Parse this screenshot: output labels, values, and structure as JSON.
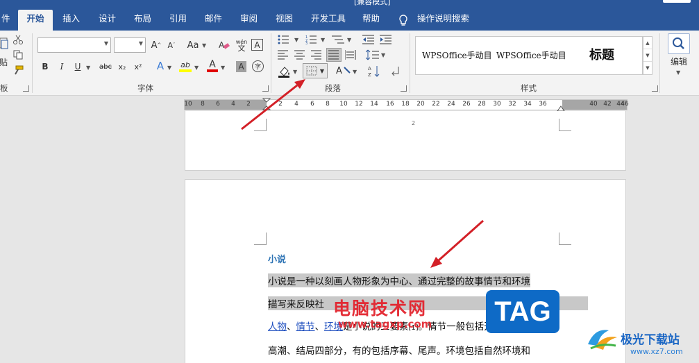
{
  "window": {
    "title": "[兼容模式]"
  },
  "tabs": [
    {
      "label": "件",
      "active": false
    },
    {
      "label": "开始",
      "active": true
    },
    {
      "label": "插入",
      "active": false
    },
    {
      "label": "设计",
      "active": false
    },
    {
      "label": "布局",
      "active": false
    },
    {
      "label": "引用",
      "active": false
    },
    {
      "label": "邮件",
      "active": false
    },
    {
      "label": "审阅",
      "active": false
    },
    {
      "label": "视图",
      "active": false
    },
    {
      "label": "开发工具",
      "active": false
    },
    {
      "label": "帮助",
      "active": false
    }
  ],
  "tell_me": {
    "label": "操作说明搜索",
    "icon": "lightbulb-icon"
  },
  "ribbon": {
    "clipboard": {
      "label": "板",
      "paste_label": "贴"
    },
    "font": {
      "label": "字体",
      "font_name": "",
      "font_size": "",
      "change_case": "Aa",
      "phonetic_top": "wén",
      "phonetic_bottom": "文",
      "char_border": "A",
      "bold": "B",
      "italic": "I",
      "underline": "U",
      "strike": "abc",
      "subscript": "x₂",
      "superscript": "x²",
      "text_effect": "A",
      "highlight": "ab",
      "font_color": "A",
      "char_shading": "A",
      "enclose": "字"
    },
    "paragraph": {
      "label": "段落"
    },
    "styles": {
      "label": "样式",
      "items": [
        "WPSOffice手动目",
        "WPSOffice手动目"
      ],
      "title_item": "标题"
    },
    "editing": {
      "label": "编辑"
    }
  },
  "colors": {
    "accent": "#2b579a",
    "highlight_yellow": "#ffff00",
    "font_red": "#e00000",
    "arrow_red": "#d32027",
    "heading_blue": "#2e74b5",
    "link_blue": "#1f4fbf"
  },
  "ruler": {
    "labels": [
      "10",
      "8",
      "6",
      "4",
      "2",
      "2",
      "4",
      "6",
      "8",
      "10",
      "12",
      "14",
      "16",
      "18",
      "20",
      "22",
      "24",
      "26",
      "28",
      "30",
      "32",
      "34",
      "36",
      "40",
      "42",
      "44",
      "46"
    ]
  },
  "document": {
    "page1_number": "2",
    "heading": "小说",
    "line1": "小说是一种以刻画人物形象为中心、通过完整的故事情节和环境",
    "line2": "描写来反映社",
    "line3_link1": "人物",
    "line3_sep1": "、",
    "line3_link2": "情节",
    "line3_sep2": "、",
    "line3_link3": "环境",
    "line3_rest": "是小说的三要素",
    "line3_cite": "[1]",
    "line3_tail": "。情节一般包括开端、发展、",
    "line4": "高潮、结局四部分，有的包括序幕、尾声。环境包括自然环境和"
  },
  "watermark": {
    "brand": "电脑技术网",
    "url": "www.tagxp.com",
    "tag": "TAG",
    "site": "极光下载站",
    "site_url": "www.xz7.com"
  }
}
